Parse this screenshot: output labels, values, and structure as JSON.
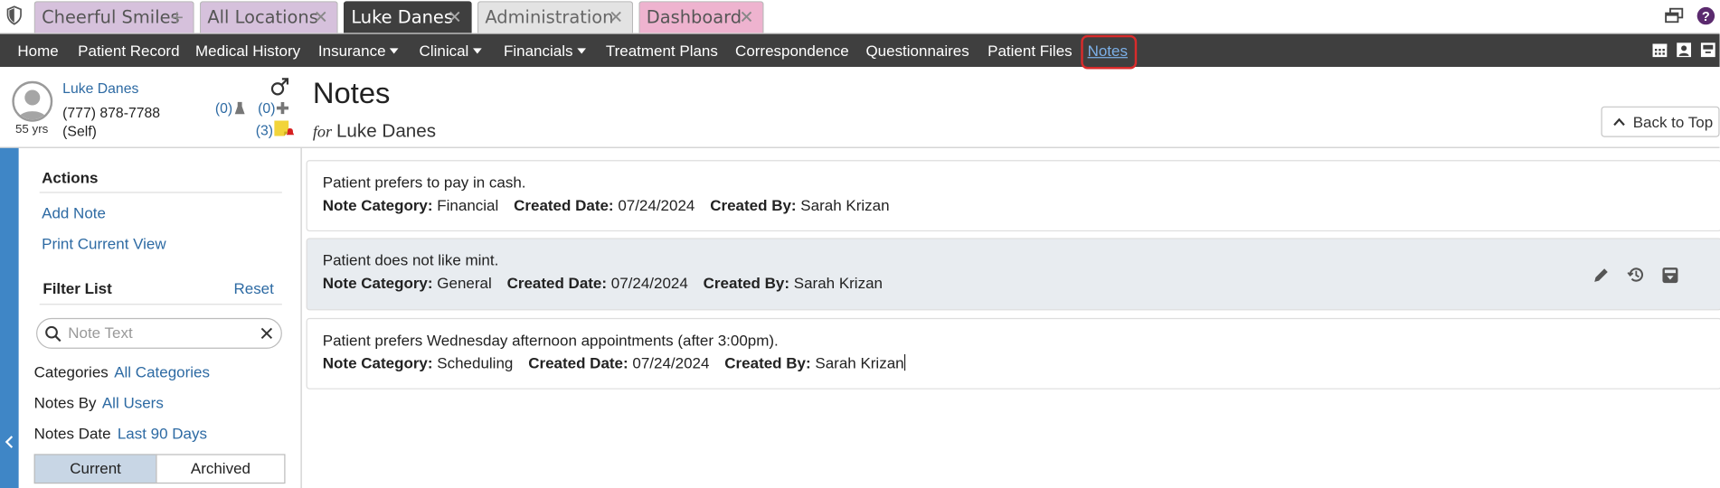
{
  "tabs": [
    {
      "label": "Cheerful Smiles",
      "action": "+"
    },
    {
      "label": "All Locations",
      "action": "✕"
    },
    {
      "label": "Luke Danes",
      "action": "✕"
    },
    {
      "label": "Administration",
      "action": "✕"
    },
    {
      "label": "Dashboard",
      "action": "✕"
    }
  ],
  "nav": {
    "items": [
      "Home",
      "Patient Record",
      "Medical History",
      "Insurance",
      "Clinical",
      "Financials",
      "Treatment Plans",
      "Correspondence",
      "Questionnaires",
      "Patient Files",
      "Notes"
    ],
    "active": "Notes"
  },
  "patient": {
    "name": "Luke Danes",
    "age": "55 yrs",
    "phone": "(777) 878-7788",
    "relation": "(Self)",
    "count_lab": "(0)",
    "count_med": "(0)",
    "count_notes": "(3)"
  },
  "page": {
    "title": "Notes",
    "for_label": "for",
    "for_name": "Luke Danes",
    "back_to_top": "Back to Top"
  },
  "sidebar": {
    "actions_heading": "Actions",
    "add_note": "Add Note",
    "print_view": "Print Current View",
    "filter_heading": "Filter List",
    "reset": "Reset",
    "search_placeholder": "Note Text",
    "categories_label": "Categories",
    "categories_value": "All Categories",
    "notes_by_label": "Notes By",
    "notes_by_value": "All Users",
    "notes_date_label": "Notes Date",
    "notes_date_value": "Last 90 Days",
    "seg_current": "Current",
    "seg_archived": "Archived"
  },
  "labels": {
    "category": "Note Category:",
    "created_date": "Created Date:",
    "created_by": "Created By:"
  },
  "notes": [
    {
      "text": "Patient prefers to pay in cash.",
      "category": "Financial",
      "date": "07/24/2024",
      "by": "Sarah Krizan"
    },
    {
      "text": "Patient does not like mint.",
      "category": "General",
      "date": "07/24/2024",
      "by": "Sarah Krizan"
    },
    {
      "text": "Patient prefers Wednesday afternoon appointments (after 3:00pm).",
      "category": "Scheduling",
      "date": "07/24/2024",
      "by": "Sarah Krizan"
    }
  ],
  "colors": {
    "navbar": "#3f3f3f",
    "accent_blue": "#2d6aa3",
    "active_nav": "#7cb0e8",
    "highlight_red": "#d92b2b",
    "tab_purple": "#d6c1dc",
    "tab_pink": "#eeb3cf"
  }
}
